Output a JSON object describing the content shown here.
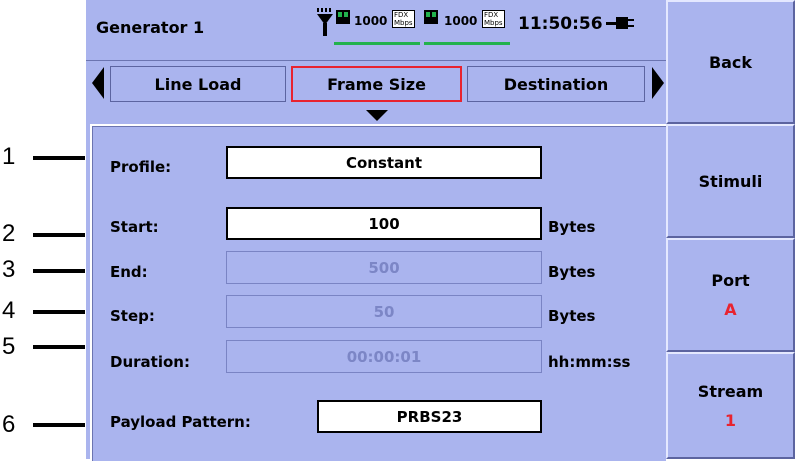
{
  "callouts": [
    "1",
    "2",
    "3",
    "4",
    "5",
    "6"
  ],
  "header": {
    "title": "Generator 1",
    "port1_speed": "1000",
    "port1_duplex": "FDX",
    "port1_unit": "Mbps",
    "port2_speed": "1000",
    "port2_duplex": "FDX",
    "port2_unit": "Mbps",
    "clock": "11:50:56",
    "icons": [
      "antenna-icon",
      "port-link-icon",
      "port-link-icon",
      "power-plug-icon"
    ],
    "link_color": "#22b24c"
  },
  "tabs": [
    {
      "label": "Line Load",
      "active": false
    },
    {
      "label": "Frame Size",
      "active": true
    },
    {
      "label": "Destination",
      "active": false
    }
  ],
  "form": {
    "profile": {
      "label": "Profile:",
      "value": "Constant"
    },
    "start": {
      "label": "Start:",
      "value": "100",
      "unit": "Bytes"
    },
    "end": {
      "label": "End:",
      "value": "500",
      "unit": "Bytes"
    },
    "step": {
      "label": "Step:",
      "value": "50",
      "unit": "Bytes"
    },
    "duration": {
      "label": "Duration:",
      "value": "00:00:01",
      "unit": "hh:mm:ss"
    },
    "payload": {
      "label": "Payload Pattern:",
      "value": "PRBS23"
    }
  },
  "softkeys": [
    {
      "label": "Back"
    },
    {
      "label": "Stimuli"
    },
    {
      "label": "Port",
      "value": "A"
    },
    {
      "label": "Stream",
      "value": "1"
    }
  ],
  "colors": {
    "background": "#aab4ee",
    "active_tab_border": "#e8232f",
    "softkey_value": "#e8232f",
    "disabled_text": "#7c86c6"
  }
}
